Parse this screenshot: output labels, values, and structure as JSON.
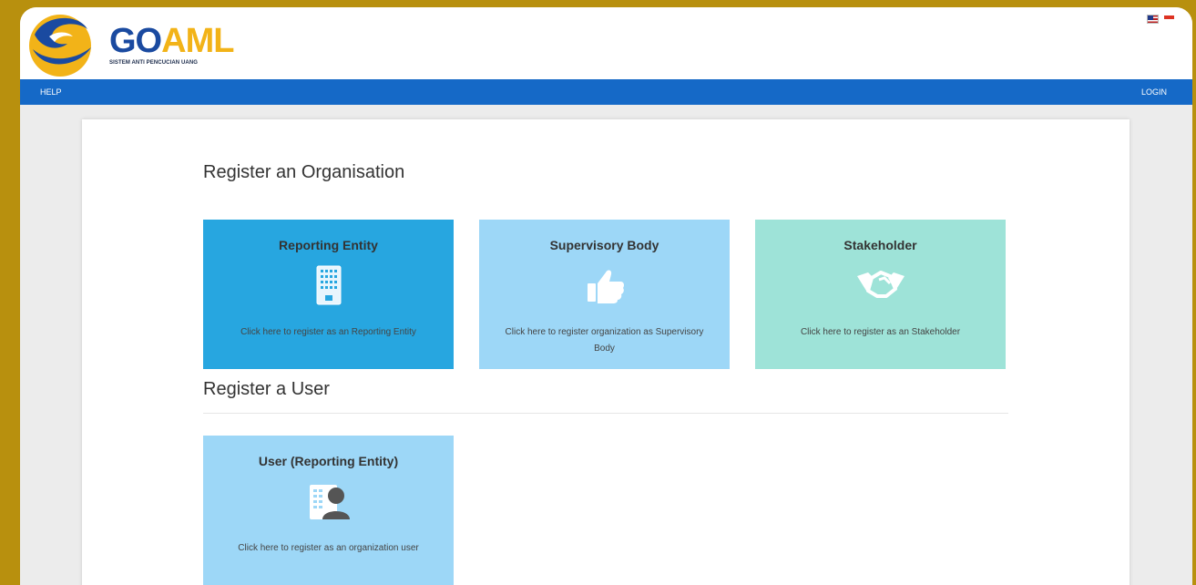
{
  "brand": {
    "name_part1": "GO",
    "name_part2": "AML",
    "tagline": "SISTEM ANTI PENCUCIAN UANG"
  },
  "nav": {
    "help": "HELP",
    "login": "LOGIN"
  },
  "sections": {
    "organisation_title": "Register an Organisation",
    "user_title": "Register a User"
  },
  "cards": {
    "reporting_entity": {
      "title": "Reporting Entity",
      "description": "Click here to register as an Reporting Entity",
      "icon": "building-icon",
      "color": "#27a6e0"
    },
    "supervisory_body": {
      "title": "Supervisory Body",
      "description": "Click here to register organization as Supervisory Body",
      "icon": "thumbs-up-icon",
      "color": "#9dd7f7"
    },
    "stakeholder": {
      "title": "Stakeholder",
      "description": "Click here to register as an Stakeholder",
      "icon": "handshake-icon",
      "color": "#9ee3d8"
    },
    "user_reporting_entity": {
      "title": "User (Reporting Entity)",
      "description": "Click here to register as an organization user",
      "icon": "user-profile-icon",
      "color": "#9dd7f7"
    }
  },
  "colors": {
    "frame": "#b8900e",
    "navbar": "#1569c7",
    "brand_blue": "#1a4aa0",
    "brand_gold": "#f2b318"
  },
  "language_flags": [
    "english-flag-icon",
    "indonesia-flag-icon"
  ]
}
